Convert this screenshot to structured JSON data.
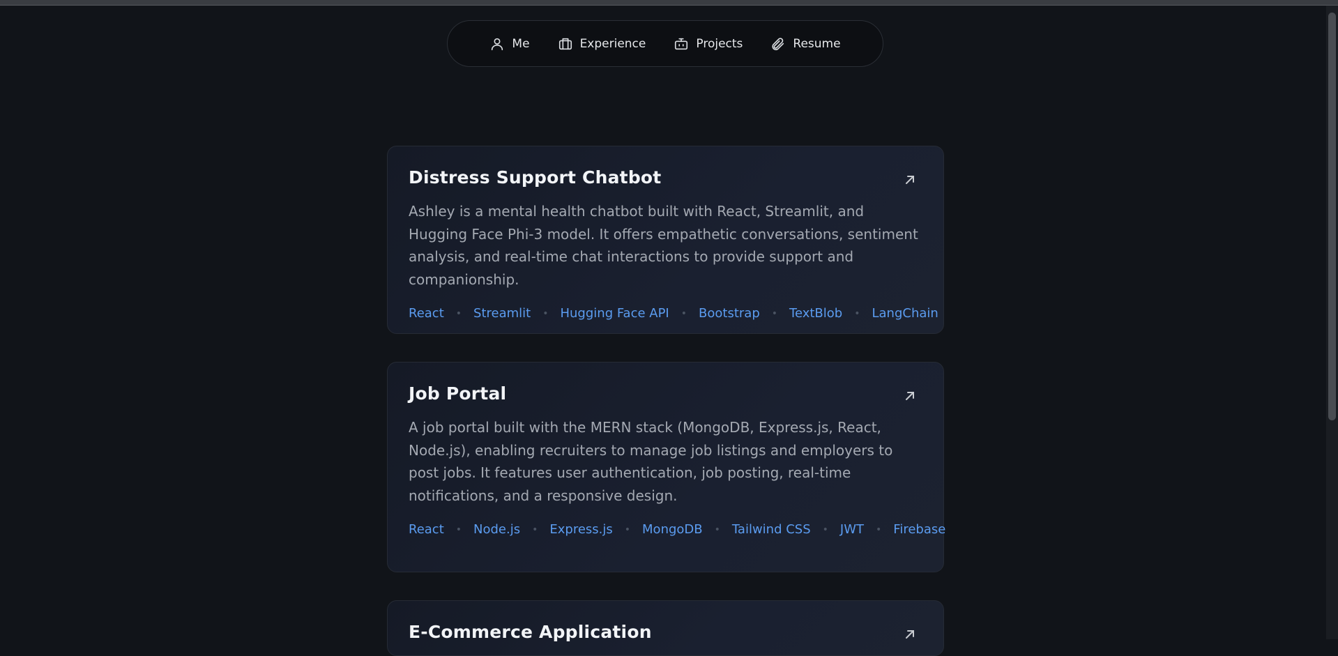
{
  "nav": {
    "items": [
      {
        "label": "Me",
        "icon": "user-icon"
      },
      {
        "label": "Experience",
        "icon": "briefcase-icon"
      },
      {
        "label": "Projects",
        "icon": "robot-icon"
      },
      {
        "label": "Resume",
        "icon": "paperclip-icon"
      }
    ]
  },
  "projects": [
    {
      "title": "Distress Support Chatbot",
      "description": "Ashley is a mental health chatbot built with React, Streamlit, and Hugging Face Phi-3 model. It offers empathetic conversations, sentiment analysis, and real-time chat interactions to provide support and companionship.",
      "tags": [
        "React",
        "Streamlit",
        "Hugging Face API",
        "Bootstrap",
        "TextBlob",
        "LangChain"
      ]
    },
    {
      "title": "Job Portal",
      "description": "A job portal built with the MERN stack (MongoDB, Express.js, React, Node.js), enabling recruiters to manage job listings and employers to post jobs. It features user authentication, job posting, real-time notifications, and a responsive design.",
      "tags": [
        "React",
        "Node.js",
        "Express.js",
        "MongoDB",
        "Tailwind CSS",
        "JWT",
        "Firebase"
      ]
    },
    {
      "title": "E-Commerce Application",
      "description": "",
      "tags": []
    }
  ],
  "colors": {
    "background": "#111419",
    "tag": "#5b9cf0",
    "card_border": "#262b35"
  }
}
